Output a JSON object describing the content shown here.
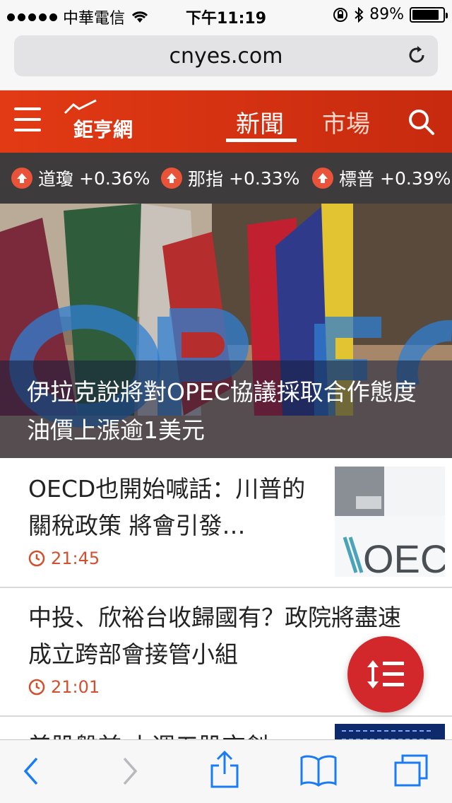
{
  "status_bar": {
    "carrier": "中華電信",
    "time": "下午11:19",
    "battery": "89%",
    "battery_level": 0.89
  },
  "browser": {
    "url": "cnyes.com"
  },
  "header": {
    "logo": "鉅亨網",
    "tabs": [
      {
        "label": "新聞",
        "active": true
      },
      {
        "label": "市場",
        "active": false
      }
    ]
  },
  "ticker": [
    {
      "name": "道瓊",
      "change": "+0.36%"
    },
    {
      "name": "那指",
      "change": "+0.33%"
    },
    {
      "name": "標普",
      "change": "+0.39%"
    }
  ],
  "hero": {
    "title": "伊拉克說將對OPEC協議採取合作態度 油價上漲逾1美元"
  },
  "articles": [
    {
      "title": "OECD也開始喊話：川普的關稅政策 將會引發…",
      "time": "21:45",
      "has_thumb": true
    },
    {
      "title": "中投、欣裕台收歸國有？政院將盡速成立跨部會接管小組",
      "time": "21:01",
      "has_thumb": false
    },
    {
      "title": "美股盤前 上週五股市創",
      "time": "",
      "has_thumb": true
    }
  ],
  "colors": {
    "brand": "#e23a14",
    "ticker_bg": "#3d3b3b",
    "time": "#d3502e",
    "fab": "#d3282b"
  },
  "icons": [
    "wifi-icon",
    "lock-rotation-icon",
    "bluetooth-icon",
    "reload-icon",
    "hamburger-icon",
    "search-icon",
    "up-arrow-icon",
    "clock-icon",
    "sort-list-icon",
    "back-icon",
    "forward-icon",
    "share-icon",
    "bookmarks-icon",
    "tabs-icon"
  ]
}
